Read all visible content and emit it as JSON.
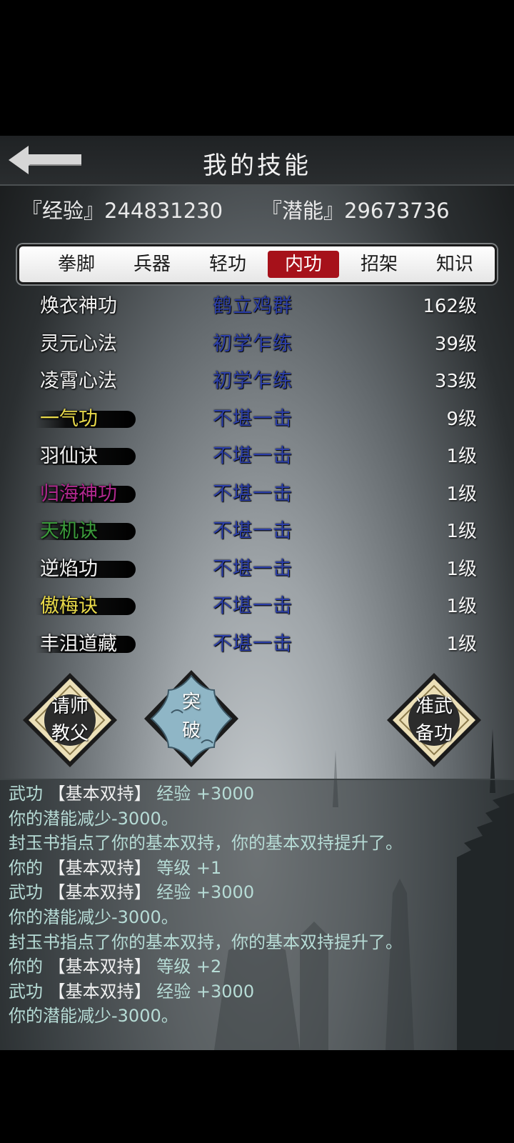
{
  "header": {
    "title": "我的技能",
    "back_icon": "back-arrow-icon"
  },
  "stats": {
    "experience_label": "『经验』",
    "experience_value": "244831230",
    "potential_label": "『潜能』",
    "potential_value": "29673736"
  },
  "tabs": [
    {
      "label": "拳脚",
      "active": false
    },
    {
      "label": "兵器",
      "active": false
    },
    {
      "label": "轻功",
      "active": false
    },
    {
      "label": "内功",
      "active": true
    },
    {
      "label": "招架",
      "active": false
    },
    {
      "label": "知识",
      "active": false
    }
  ],
  "skills": [
    {
      "name": "焕衣神功",
      "rank": "鹤立鸡群",
      "level": "162级",
      "name_color": "#f2f2f2"
    },
    {
      "name": "灵元心法",
      "rank": "初学乍练",
      "level": "39级",
      "name_color": "#f2f2f2"
    },
    {
      "name": "凌霄心法",
      "rank": "初学乍练",
      "level": "33级",
      "name_color": "#f2f2f2"
    },
    {
      "name": "一气功",
      "rank": "不堪一击",
      "level": "9级",
      "name_color": "#e8d94a"
    },
    {
      "name": "羽仙诀",
      "rank": "不堪一击",
      "level": "1级",
      "name_color": "#f2f2f2"
    },
    {
      "name": "归海神功",
      "rank": "不堪一击",
      "level": "1级",
      "name_color": "#b0288e"
    },
    {
      "name": "天机诀",
      "rank": "不堪一击",
      "level": "1级",
      "name_color": "#3a9a3a"
    },
    {
      "name": "逆焰功",
      "rank": "不堪一击",
      "level": "1级",
      "name_color": "#f2f2f2"
    },
    {
      "name": "傲梅诀",
      "rank": "不堪一击",
      "level": "1级",
      "name_color": "#e8d94a"
    },
    {
      "name": "丰沮道藏",
      "rank": "不堪一击",
      "level": "1级",
      "name_color": "#f2f2f2"
    }
  ],
  "actions": {
    "hire_master": {
      "line1": "请师",
      "line2": "教父"
    },
    "breakthrough": {
      "line1": "突",
      "line2": "破"
    },
    "prepare": {
      "line1": "准武",
      "line2": "备功"
    }
  },
  "log": [
    {
      "pre": "武功 ",
      "br": "【基本双持】",
      "post": " 经验 +3000"
    },
    {
      "pre": "你的潜能减少-3000。",
      "br": "",
      "post": ""
    },
    {
      "pre": "封玉书指点了你的基本双持，你的基本双持提升了。",
      "br": "",
      "post": ""
    },
    {
      "pre": "你的 ",
      "br": "【基本双持】",
      "post": " 等级 +1"
    },
    {
      "pre": "武功 ",
      "br": "【基本双持】",
      "post": " 经验 +3000"
    },
    {
      "pre": "你的潜能减少-3000。",
      "br": "",
      "post": ""
    },
    {
      "pre": "封玉书指点了你的基本双持，你的基本双持提升了。",
      "br": "",
      "post": ""
    },
    {
      "pre": "你的 ",
      "br": "【基本双持】",
      "post": " 等级 +2"
    },
    {
      "pre": "武功 ",
      "br": "【基本双持】",
      "post": " 经验 +3000"
    },
    {
      "pre": "你的潜能减少-3000。",
      "br": "",
      "post": ""
    }
  ]
}
